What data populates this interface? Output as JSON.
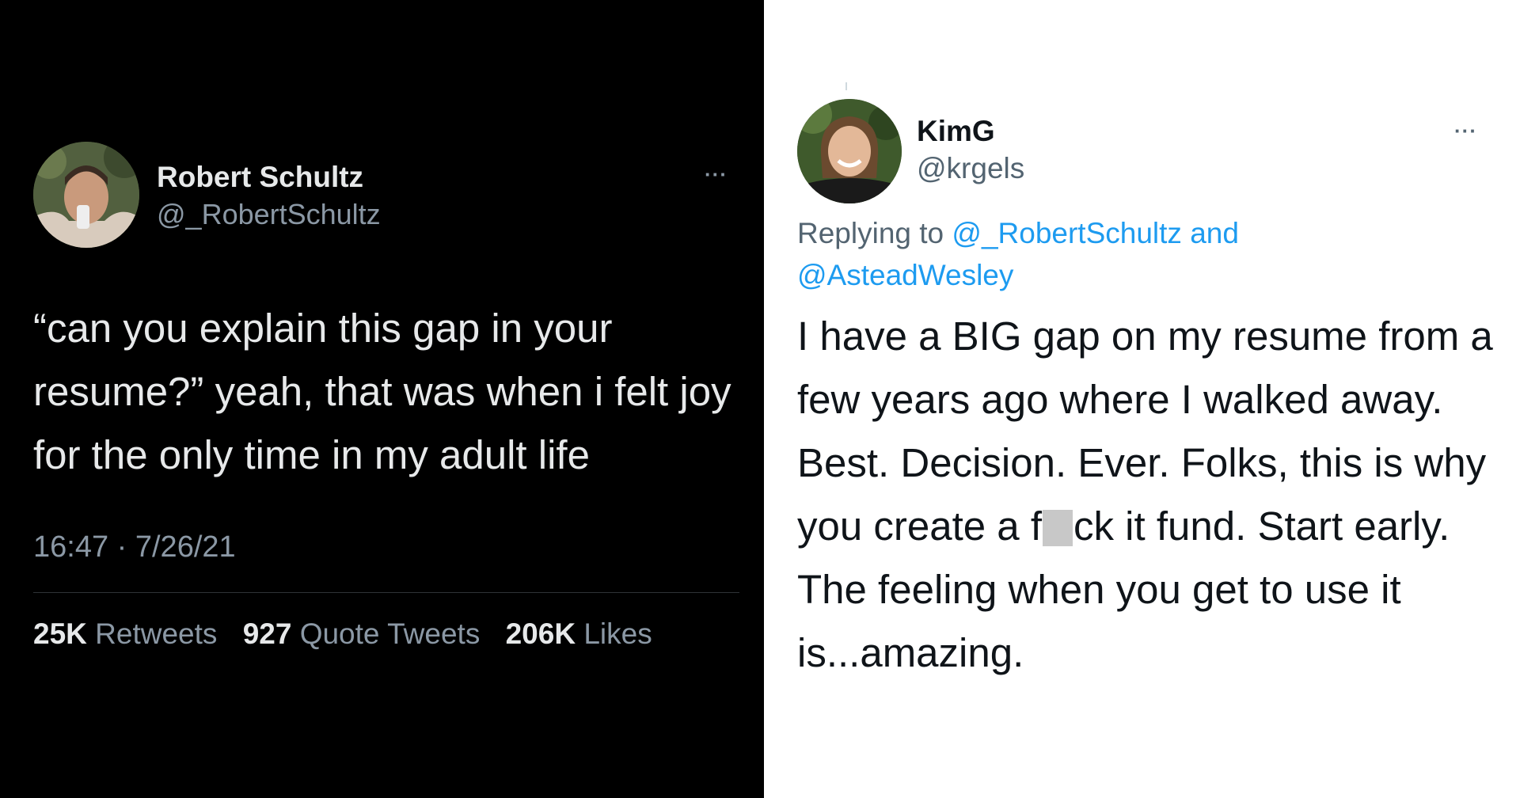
{
  "left_tweet": {
    "author_name": "Robert Schultz",
    "author_handle": "@_RobertSchultz",
    "more_label": "···",
    "text": "“can you explain this gap in your resume?” yeah, that was when i felt joy for the only time in my adult life",
    "timestamp": "16:47 · 7/26/21",
    "stats": {
      "retweets_count": "25K",
      "retweets_label": "Retweets",
      "quotes_count": "927",
      "quotes_label": "Quote Tweets",
      "likes_count": "206K",
      "likes_label": "Likes"
    },
    "background": "#000000",
    "text_color": "#e7e9ea",
    "secondary_color": "#8b98a5"
  },
  "right_tweet": {
    "author_name": "KimG",
    "author_handle": "@krgels",
    "more_label": "···",
    "replying_prefix": "Replying to",
    "replying_mention_1": "@_RobertSchultz",
    "replying_and": "and",
    "replying_mention_2": "@AsteadWesley",
    "text_part_1": "I have a BIG gap on my resume from a few years ago where I walked away. Best. Decision. Ever. Folks, this is why you create a f",
    "text_part_2": "ck it fund. Start early. The feeling  when you get to use it is...amazing.",
    "background": "#ffffff",
    "text_color": "#0f1419",
    "secondary_color": "#536471",
    "mention_color": "#1d9bf0"
  },
  "icons": {
    "left_avatar": "profile-photo",
    "right_avatar": "profile-photo",
    "more": "ellipsis-icon"
  }
}
